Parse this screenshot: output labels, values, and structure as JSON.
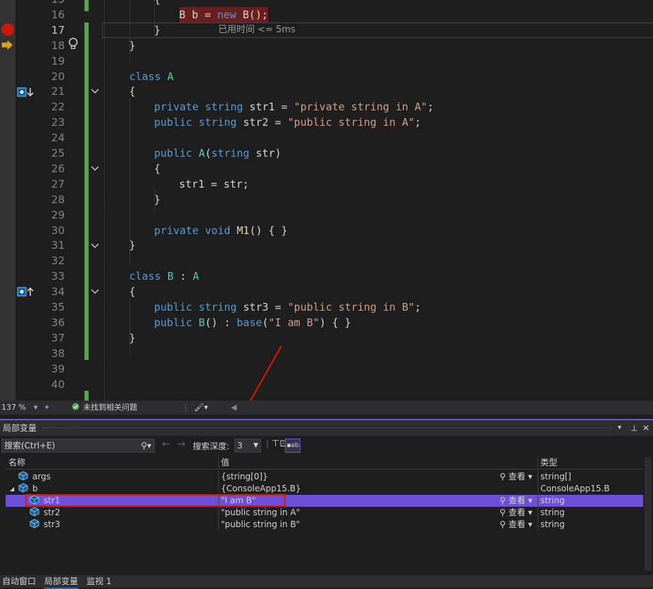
{
  "editor": {
    "lines": [
      {
        "num": "15",
        "code": [
          [
            "txt",
            "{"
          ]
        ]
      },
      {
        "num": "16",
        "code": [
          [
            "txt",
            "B "
          ],
          [
            "txt",
            "b"
          ],
          [
            "txt",
            " = "
          ],
          [
            "kw",
            "new "
          ],
          [
            "txt",
            "B"
          ],
          [
            "txt",
            "();"
          ]
        ]
      },
      {
        "num": "17",
        "code": [
          [
            "txt",
            "}"
          ]
        ]
      },
      {
        "num": "18",
        "code": [
          [
            "txt",
            "}"
          ]
        ]
      },
      {
        "num": "19",
        "code": []
      },
      {
        "num": "20",
        "code": [
          [
            "kw",
            "class "
          ],
          [
            "cls",
            "A"
          ]
        ]
      },
      {
        "num": "21",
        "code": [
          [
            "txt",
            "{"
          ]
        ]
      },
      {
        "num": "22",
        "code": [
          [
            "kw",
            "private string "
          ],
          [
            "txt",
            "str1 = "
          ],
          [
            "str",
            "\"private string in A\""
          ],
          [
            "txt",
            ";"
          ]
        ]
      },
      {
        "num": "23",
        "code": [
          [
            "kw",
            "public string "
          ],
          [
            "txt",
            "str2 = "
          ],
          [
            "str",
            "\"public string in A\""
          ],
          [
            "txt",
            ";"
          ]
        ]
      },
      {
        "num": "24",
        "code": []
      },
      {
        "num": "25",
        "code": [
          [
            "kw",
            "public "
          ],
          [
            "cls",
            "A"
          ],
          [
            "txt",
            "("
          ],
          [
            "kw",
            "string "
          ],
          [
            "txt",
            "str)"
          ]
        ]
      },
      {
        "num": "26",
        "code": [
          [
            "txt",
            "{"
          ]
        ]
      },
      {
        "num": "27",
        "code": [
          [
            "txt",
            "str1 = str;"
          ]
        ]
      },
      {
        "num": "28",
        "code": [
          [
            "txt",
            "}"
          ]
        ]
      },
      {
        "num": "29",
        "code": []
      },
      {
        "num": "30",
        "code": [
          [
            "kw",
            "private void "
          ],
          [
            "fn",
            "M1"
          ],
          [
            "txt",
            "() { }"
          ]
        ]
      },
      {
        "num": "31",
        "code": [
          [
            "txt",
            "}"
          ]
        ]
      },
      {
        "num": "32",
        "code": []
      },
      {
        "num": "33",
        "code": [
          [
            "kw",
            "class "
          ],
          [
            "cls",
            "B"
          ],
          [
            "txt",
            " : "
          ],
          [
            "cls",
            "A"
          ]
        ]
      },
      {
        "num": "34",
        "code": [
          [
            "txt",
            "{"
          ]
        ]
      },
      {
        "num": "35",
        "code": [
          [
            "kw",
            "public string "
          ],
          [
            "txt",
            "str3 = "
          ],
          [
            "str",
            "\"public string in B\""
          ],
          [
            "txt",
            ";"
          ]
        ]
      },
      {
        "num": "36",
        "code": [
          [
            "kw",
            "public "
          ],
          [
            "cls",
            "B"
          ],
          [
            "txt",
            "() : "
          ],
          [
            "kw",
            "base"
          ],
          [
            "txt",
            "("
          ],
          [
            "str",
            "\"I am B\""
          ],
          [
            "txt",
            ") { }"
          ]
        ]
      },
      {
        "num": "37",
        "code": [
          [
            "txt",
            "}"
          ]
        ]
      },
      {
        "num": "38",
        "code": []
      },
      {
        "num": "39",
        "code": []
      },
      {
        "num": "40",
        "code": []
      }
    ],
    "elapsed": "已用时间 <= 5ms"
  },
  "status": {
    "zoom": "137 %",
    "issues": "未找到相关问题"
  },
  "panel": {
    "title": "局部变量",
    "search_placeholder": "搜索(Ctrl+E)",
    "depth_label": "搜索深度:",
    "depth_value": "3",
    "columns": {
      "name": "名称",
      "value": "值",
      "type": "类型"
    },
    "view_label": "查看",
    "rows": [
      {
        "name": "args",
        "value": "{string[0]}",
        "type": "string[]",
        "view": true,
        "indent": 0,
        "expander": ""
      },
      {
        "name": "b",
        "value": "{ConsoleApp15.B}",
        "type": "ConsoleApp15.B",
        "view": false,
        "indent": 0,
        "expander": "◢"
      },
      {
        "name": "str1",
        "value": "\"I am B\"",
        "type": "string",
        "view": true,
        "indent": 1,
        "expander": "",
        "selected": true
      },
      {
        "name": "str2",
        "value": "\"public string in A\"",
        "type": "string",
        "view": true,
        "indent": 1,
        "expander": ""
      },
      {
        "name": "str3",
        "value": "\"public string in B\"",
        "type": "string",
        "view": true,
        "indent": 1,
        "expander": ""
      }
    ],
    "tabs": [
      "自动窗口",
      "局部变量",
      "监视 1"
    ]
  },
  "colors": {
    "accent": "#6e4fd7",
    "breakpoint": "#e51400",
    "annotation": "#e51400"
  }
}
